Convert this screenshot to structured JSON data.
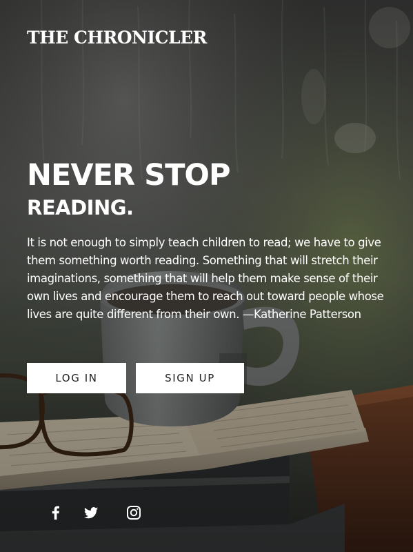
{
  "brand": {
    "name": "THE CHRONICLER"
  },
  "hero": {
    "headline": "NEVER STOP",
    "subheadline": "READING.",
    "quote": "It is not enough to simply teach children to read; we have to give them something worth reading. Something that will stretch their imaginations, something that will help them make sense of their own lives and encourage them to reach out toward people whose lives are quite different from their own. —Katherine Patterson"
  },
  "actions": {
    "login_label": "LOG IN",
    "signup_label": "SIGN UP"
  },
  "social": {
    "icons": [
      "facebook-icon",
      "twitter-icon",
      "instagram-icon"
    ]
  },
  "colors": {
    "text": "#ffffff",
    "button_bg": "#ffffff",
    "button_text": "#1d1d1d",
    "overlay": "#2c2d2c"
  }
}
